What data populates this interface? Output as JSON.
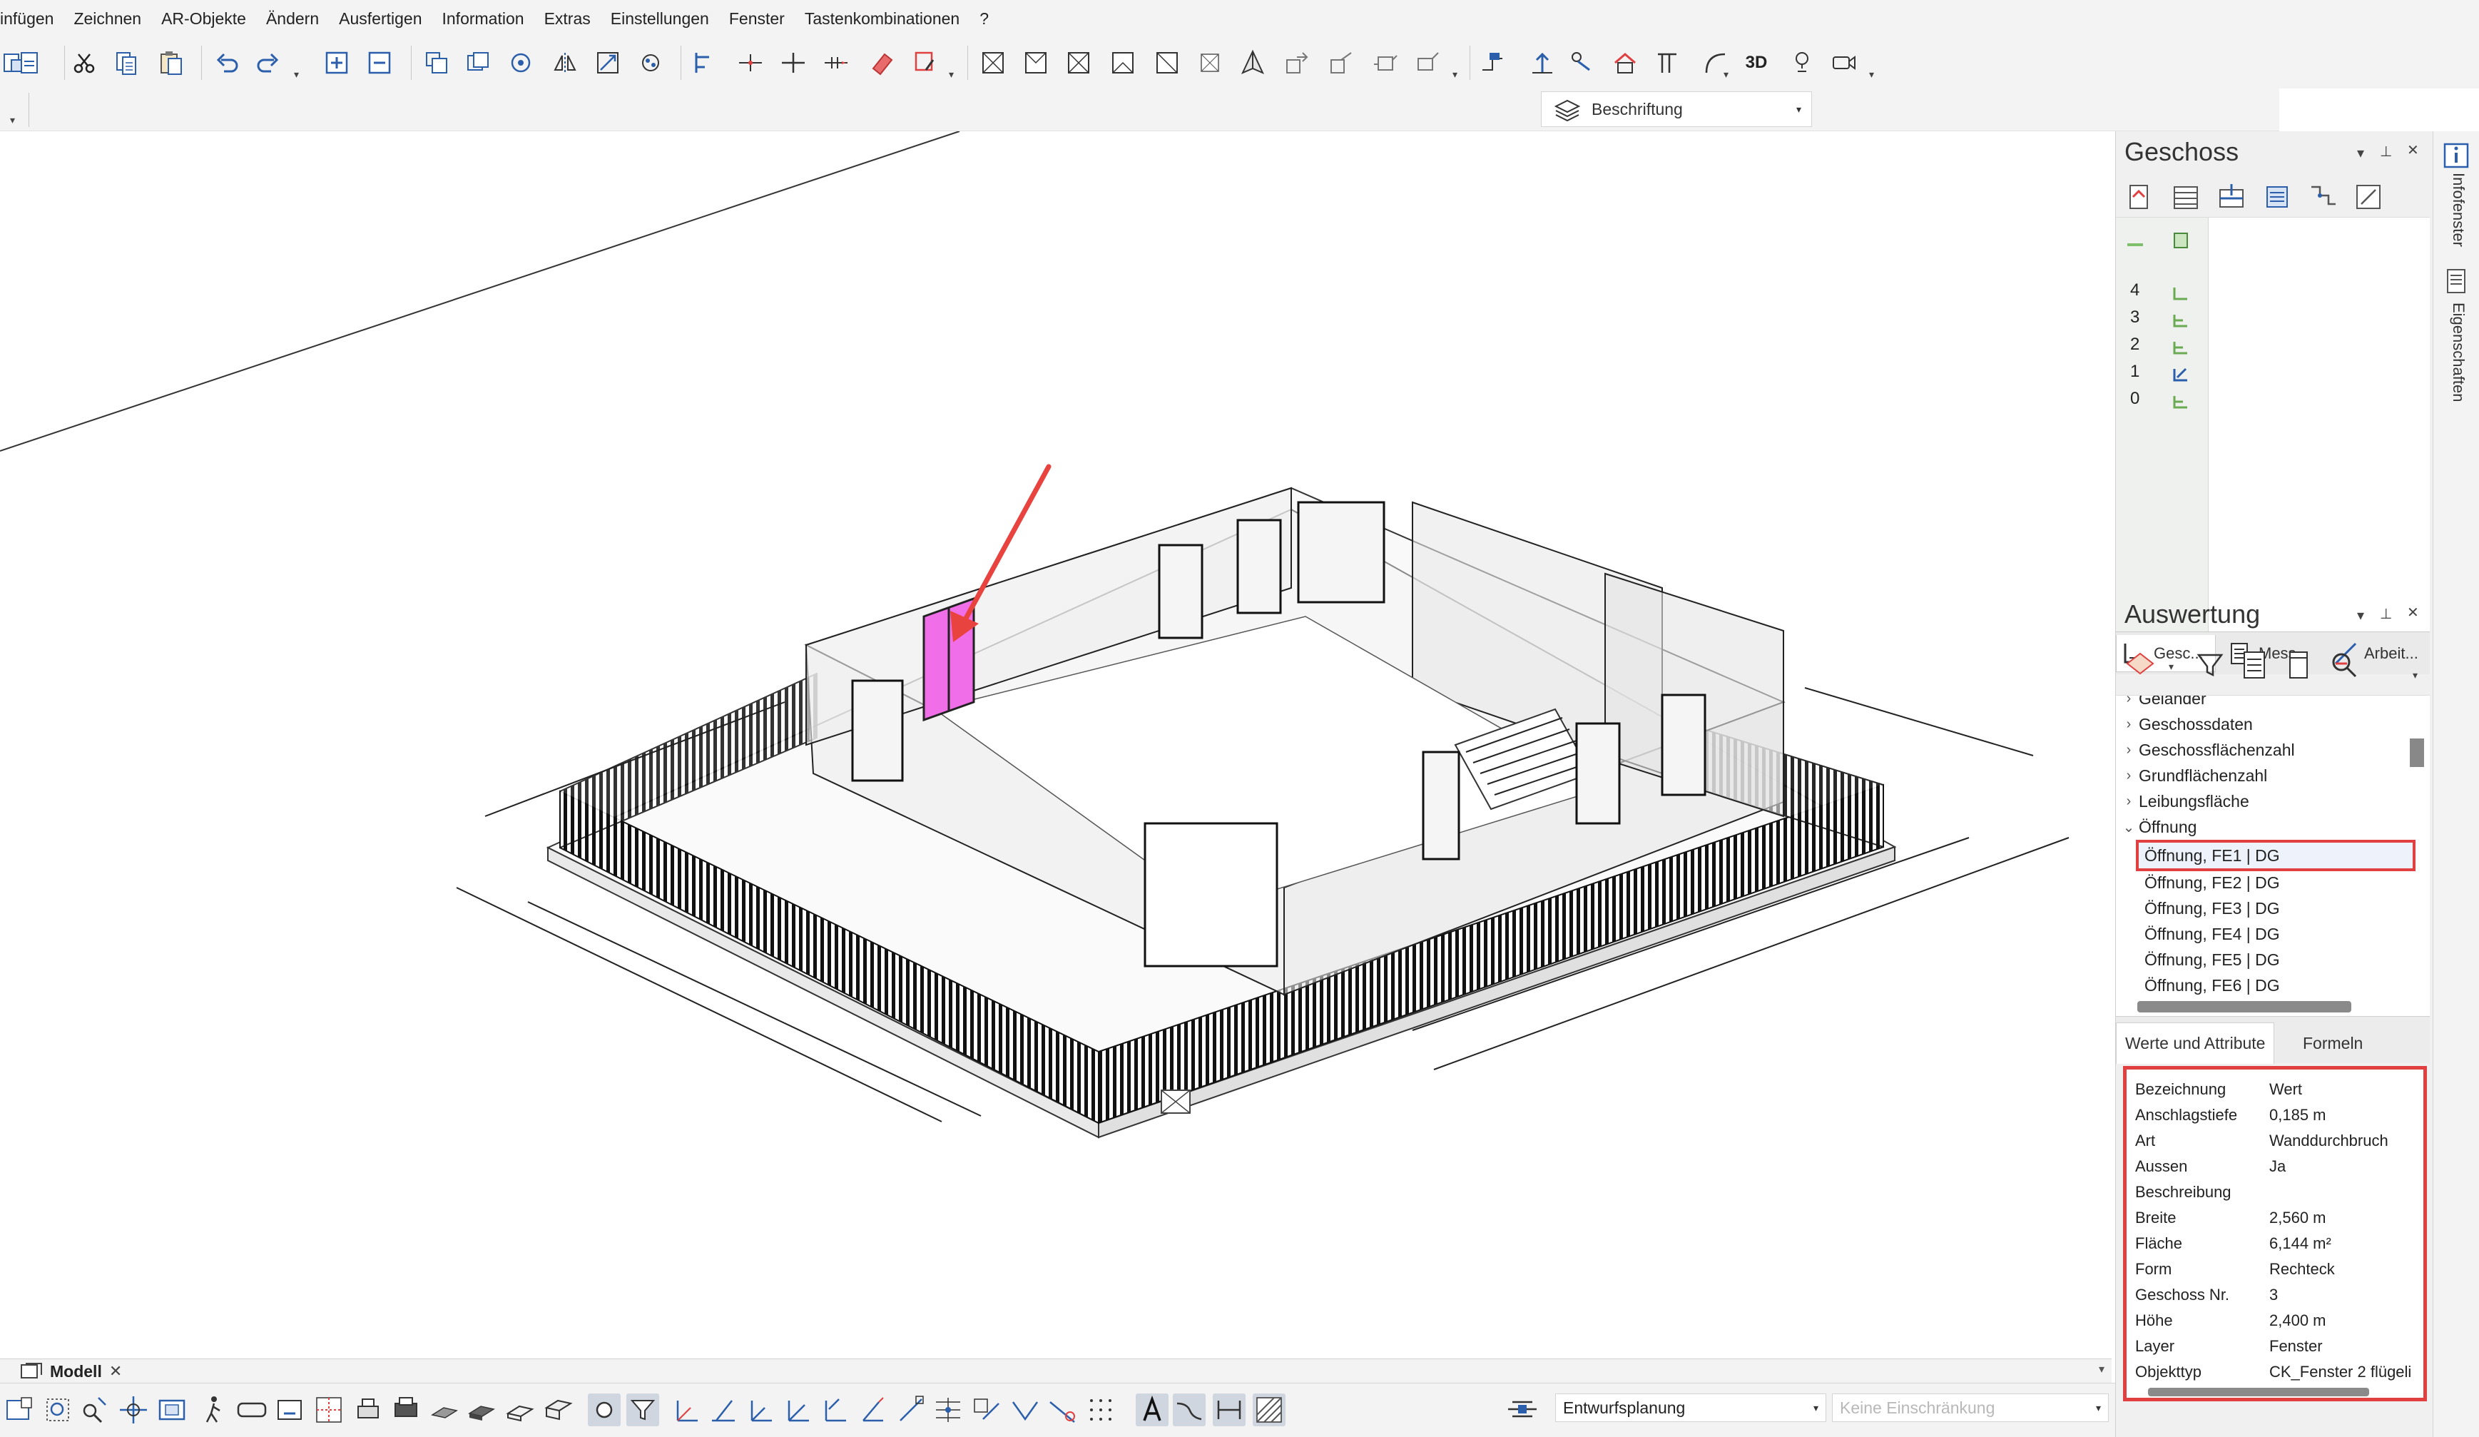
{
  "menu": [
    "infügen",
    "Zeichnen",
    "AR-Objekte",
    "Ändern",
    "Ausfertigen",
    "Information",
    "Extras",
    "Einstellungen",
    "Fenster",
    "Tastenkombinationen",
    "?"
  ],
  "toolbar": {
    "layer_combo_label": "Beschriftung",
    "icons": [
      "new-document-icon",
      "import-icon",
      "cut-icon",
      "copy-icon",
      "paste-icon",
      "undo-icon",
      "redo-icon",
      "zoom-in-icon",
      "zoom-out-icon",
      "copy-object-icon",
      "clone-icon",
      "rotate-icon",
      "mirror-icon",
      "scale-icon",
      "explode-icon",
      "align-icon",
      "move-icon",
      "offset-icon",
      "extend-icon",
      "eraser-icon",
      "format-painter-icon",
      "wall-icon",
      "opening-icon",
      "window-icon",
      "door-icon",
      "column-icon",
      "slab-icon",
      "pyramid-icon",
      "roof-icon",
      "ramp-icon",
      "stair-icon",
      "camera-icon",
      "level-icon",
      "section-icon",
      "view-icon",
      "house-icon",
      "dimension-icon",
      "arc-icon",
      "3d-icon",
      "light-icon",
      "video-icon"
    ],
    "view_3d_label": "3D"
  },
  "panels": {
    "geschoss": {
      "title": "Geschoss",
      "floors": [
        "4",
        "3",
        "2",
        "1",
        "0"
      ],
      "tabs": [
        "Gesc...",
        "Mess...",
        "Arbeit..."
      ]
    },
    "auswertung": {
      "title": "Auswertung",
      "tree": [
        {
          "label": "Geländer",
          "expanded": false
        },
        {
          "label": "Geschossdaten",
          "expanded": false
        },
        {
          "label": "Geschossflächenzahl",
          "expanded": false
        },
        {
          "label": "Grundflächenzahl",
          "expanded": false
        },
        {
          "label": "Leibungsfläche",
          "expanded": false
        },
        {
          "label": "Öffnung",
          "expanded": true
        }
      ],
      "children": [
        "Öffnung, FE1 | DG",
        "Öffnung, FE2 | DG",
        "Öffnung, FE3 | DG",
        "Öffnung, FE4 | DG",
        "Öffnung, FE5 | DG",
        "Öffnung, FE6 | DG"
      ],
      "selected_child_index": 0,
      "tabs": [
        "Werte und Attribute",
        "Formeln"
      ],
      "attributes": [
        {
          "key": "Bezeichnung",
          "value": "Wert"
        },
        {
          "key": "Anschlagstiefe",
          "value": "0,185 m"
        },
        {
          "key": "Art",
          "value": "Wanddurchbruch"
        },
        {
          "key": "Aussen",
          "value": "Ja"
        },
        {
          "key": "Beschreibung",
          "value": ""
        },
        {
          "key": "Breite",
          "value": "2,560 m"
        },
        {
          "key": "Fläche",
          "value": "6,144 m²"
        },
        {
          "key": "Form",
          "value": "Rechteck"
        },
        {
          "key": "Geschoss Nr.",
          "value": "3"
        },
        {
          "key": "Höhe",
          "value": "2,400 m"
        },
        {
          "key": "Layer",
          "value": "Fenster"
        },
        {
          "key": "Objekttyp",
          "value": "CK_Fenster 2 flügeli"
        }
      ]
    }
  },
  "side_dock": [
    "Infofenster",
    "Eigenschaften"
  ],
  "document_tab": "Modell",
  "bottom_bar": {
    "plan_combo": "Entwurfsplanung",
    "restriction_placeholder": "Keine Einschränkung"
  },
  "colors": {
    "highlight": "#e04040",
    "selected_window": "#f06ee8",
    "arrow": "#e8433f"
  }
}
